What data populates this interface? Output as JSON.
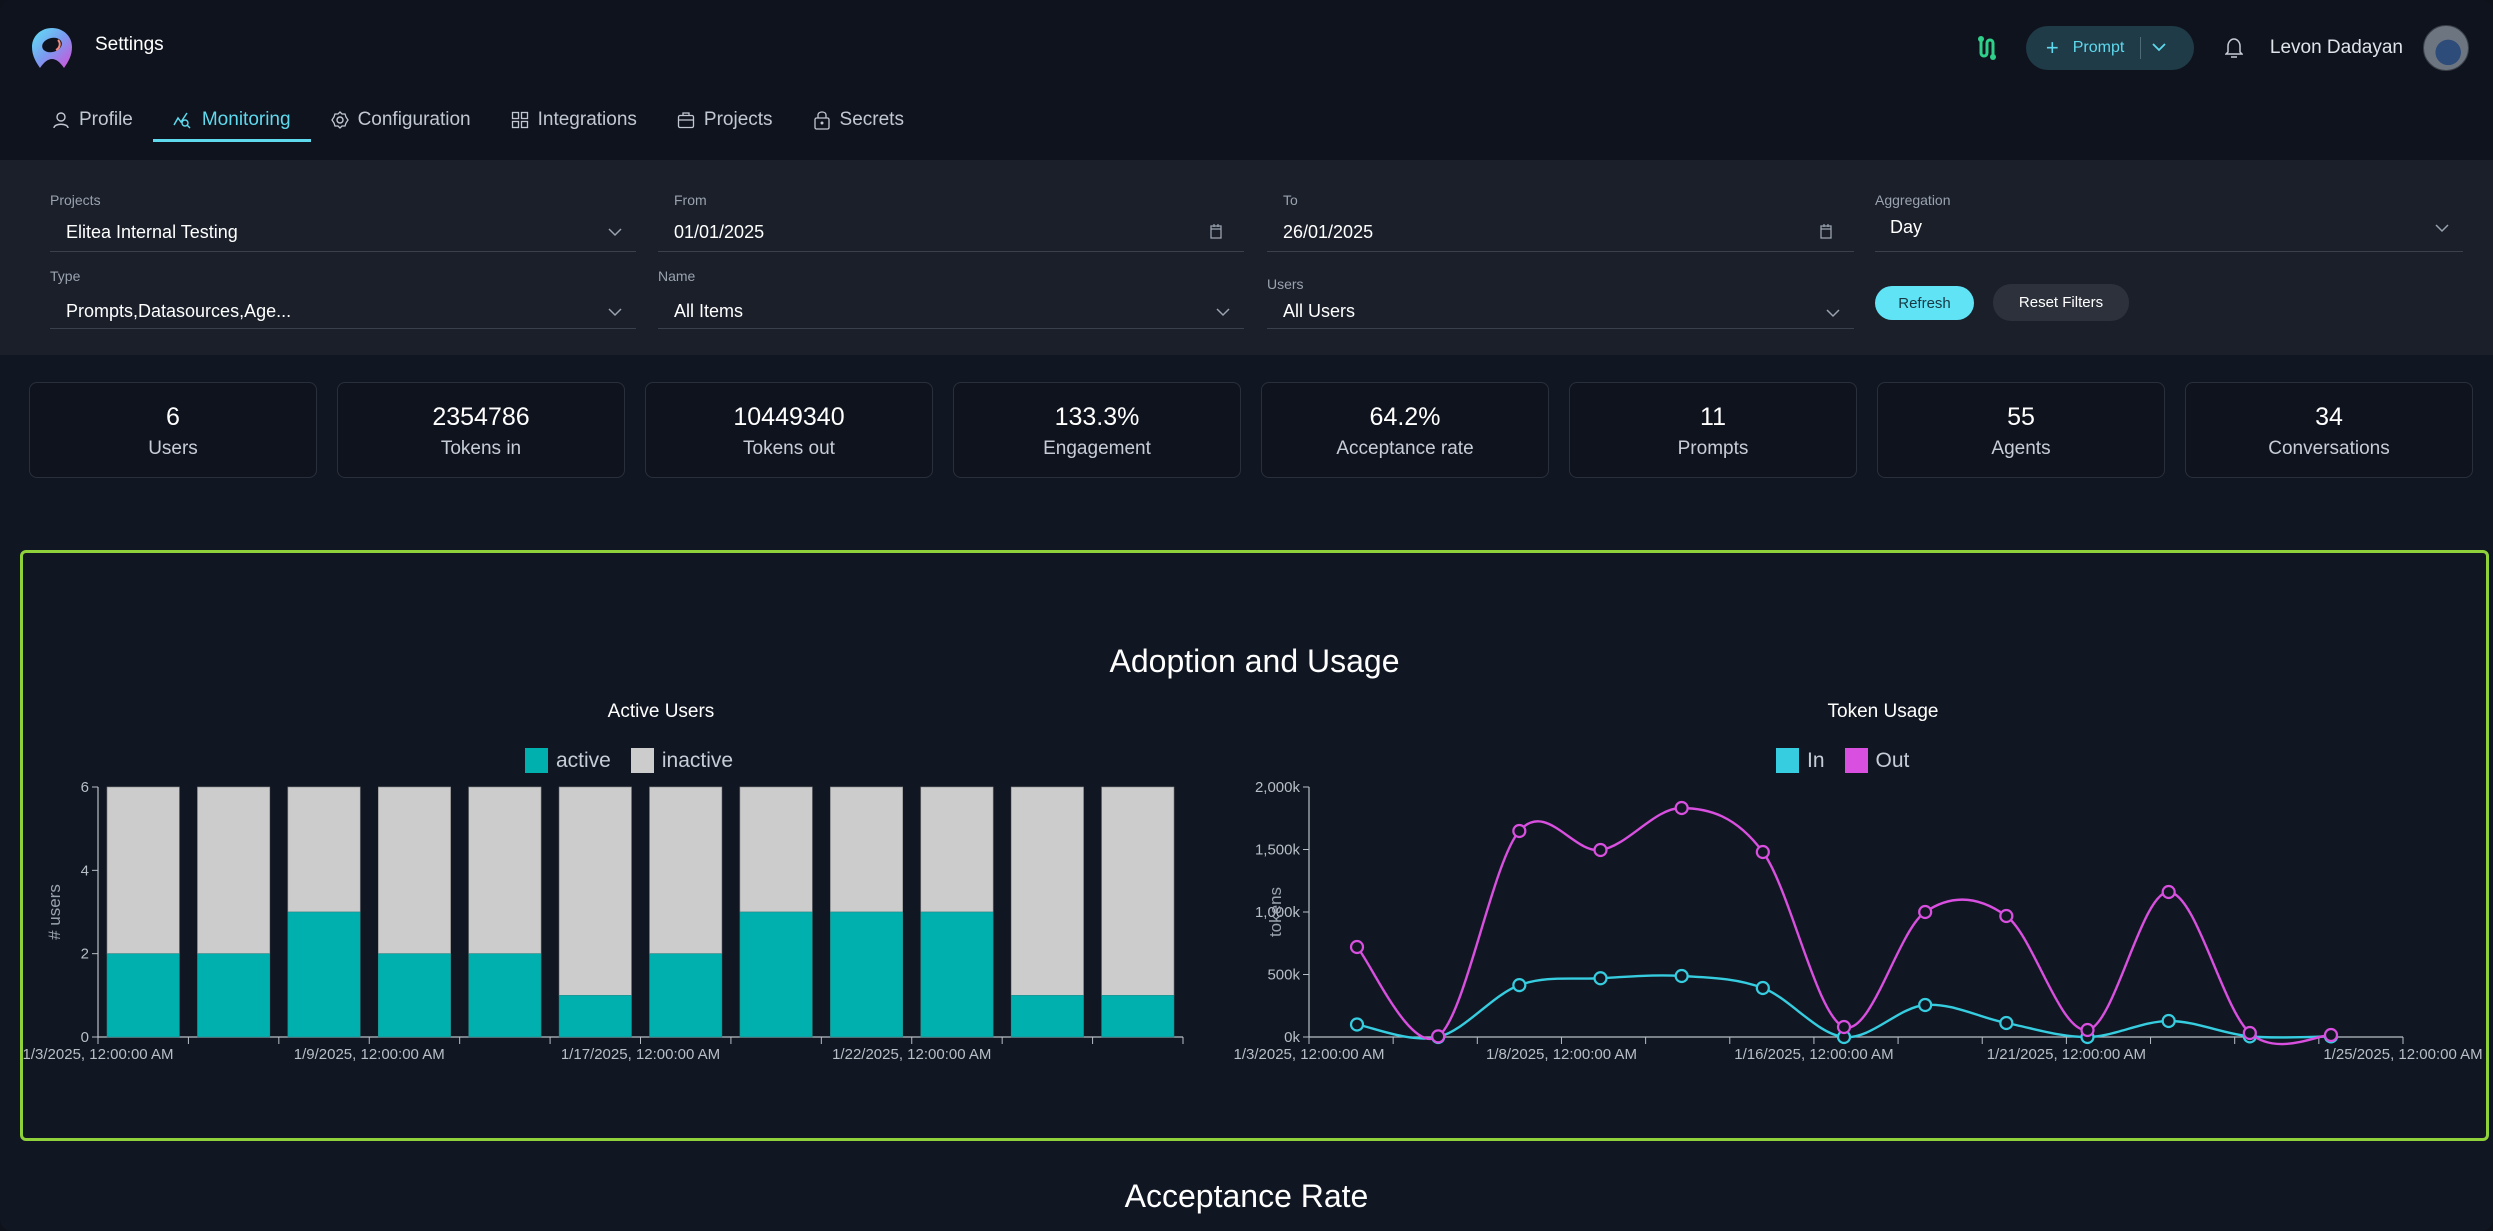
{
  "header": {
    "app_title": "Settings",
    "prompt_button": "Prompt",
    "user_name": "Levon Dadayan"
  },
  "tabs": [
    {
      "label": "Profile",
      "icon": "user-icon",
      "active": false
    },
    {
      "label": "Monitoring",
      "icon": "monitoring-icon",
      "active": true
    },
    {
      "label": "Configuration",
      "icon": "gear-icon",
      "active": false
    },
    {
      "label": "Integrations",
      "icon": "grid-icon",
      "active": false
    },
    {
      "label": "Projects",
      "icon": "briefcase-icon",
      "active": false
    },
    {
      "label": "Secrets",
      "icon": "lock-icon",
      "active": false
    }
  ],
  "filters": {
    "projects": {
      "label": "Projects",
      "value": "Elitea Internal Testing"
    },
    "from": {
      "label": "From",
      "value": "01/01/2025"
    },
    "to": {
      "label": "To",
      "value": "26/01/2025"
    },
    "aggregation": {
      "label": "Aggregation",
      "value": "Day"
    },
    "type": {
      "label": "Type",
      "value": "Prompts,Datasources,Age..."
    },
    "name": {
      "label": "Name",
      "value": "All Items"
    },
    "users": {
      "label": "Users",
      "value": "All Users"
    },
    "refresh_label": "Refresh",
    "reset_label": "Reset Filters"
  },
  "stats": [
    {
      "value": "6",
      "label": "Users"
    },
    {
      "value": "2354786",
      "label": "Tokens in"
    },
    {
      "value": "10449340",
      "label": "Tokens out"
    },
    {
      "value": "133.3%",
      "label": "Engagement"
    },
    {
      "value": "64.2%",
      "label": "Acceptance rate"
    },
    {
      "value": "11",
      "label": "Prompts"
    },
    {
      "value": "55",
      "label": "Agents"
    },
    {
      "value": "34",
      "label": "Conversations"
    }
  ],
  "section_titles": {
    "adoption": "Adoption and Usage",
    "acceptance": "Acceptance Rate"
  },
  "colors": {
    "accent": "#5fd9ee",
    "active": "#00b0ae",
    "inactive": "#cccccc",
    "tokens_in": "#36cde0",
    "tokens_out": "#d94fe0",
    "highlight_border": "#8fd13a"
  },
  "chart_data": [
    {
      "type": "bar",
      "title": "Active Users",
      "ylabel": "# users",
      "xlabel": "",
      "ylim": [
        0,
        6
      ],
      "yticks": [
        0,
        2,
        4,
        6
      ],
      "stacked": true,
      "legend": [
        "active",
        "inactive"
      ],
      "legend_position": "top-center",
      "x_tick_labels": [
        "1/3/2025, 12:00:00 AM",
        "1/9/2025, 12:00:00 AM",
        "1/17/2025, 12:00:00 AM",
        "1/22/2025, 12:00:00 AM"
      ],
      "series": [
        {
          "name": "active",
          "values": [
            2,
            2,
            3,
            2,
            2,
            1,
            2,
            3,
            3,
            3,
            1,
            1
          ]
        },
        {
          "name": "inactive",
          "values": [
            4,
            4,
            3,
            4,
            4,
            5,
            4,
            3,
            3,
            3,
            5,
            5
          ]
        }
      ]
    },
    {
      "type": "line",
      "title": "Token Usage",
      "ylabel": "tokens",
      "xlabel": "",
      "ylim": [
        0,
        2000
      ],
      "yunit": "k",
      "yticks": [
        "0k",
        "500k",
        "1,000k",
        "1,500k",
        "2,000k"
      ],
      "legend": [
        "In",
        "Out"
      ],
      "legend_position": "top-center",
      "x_tick_labels": [
        "1/3/2025, 12:00:00 AM",
        "1/8/2025, 12:00:00 AM",
        "1/16/2025, 12:00:00 AM",
        "1/21/2025, 12:00:00 AM",
        "1/25/2025, 12:00:00 AM"
      ],
      "series": [
        {
          "name": "In",
          "values": [
            100,
            0,
            415,
            470,
            488,
            392,
            0,
            256,
            112,
            0,
            128,
            5,
            5
          ]
        },
        {
          "name": "Out",
          "values": [
            720,
            5,
            1648,
            1496,
            1832,
            1480,
            80,
            1000,
            968,
            56,
            1160,
            32,
            16
          ]
        }
      ]
    }
  ]
}
